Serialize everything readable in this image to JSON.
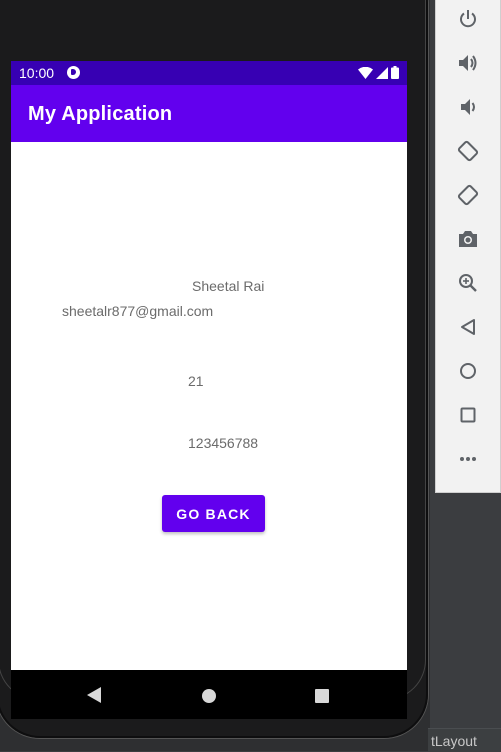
{
  "status_bar": {
    "time": "10:00"
  },
  "app_bar": {
    "title": "My Application"
  },
  "profile": {
    "name": "Sheetal Rai",
    "email": "sheetalr877@gmail.com",
    "age": "21",
    "phone": "123456788"
  },
  "actions": {
    "go_back_label": "GO BACK"
  },
  "ide": {
    "bottom_tab": "tLayout"
  },
  "emulator_toolbar": {
    "buttons": [
      "power-icon",
      "volume-up-icon",
      "volume-down-icon",
      "rotate-left-icon",
      "rotate-right-icon",
      "camera-icon",
      "zoom-icon",
      "back-icon",
      "home-icon",
      "overview-icon",
      "more-icon"
    ]
  },
  "colors": {
    "primary": "#6200ee",
    "primary_dark": "#3700b3",
    "toolbar_icon": "#5f6368"
  }
}
